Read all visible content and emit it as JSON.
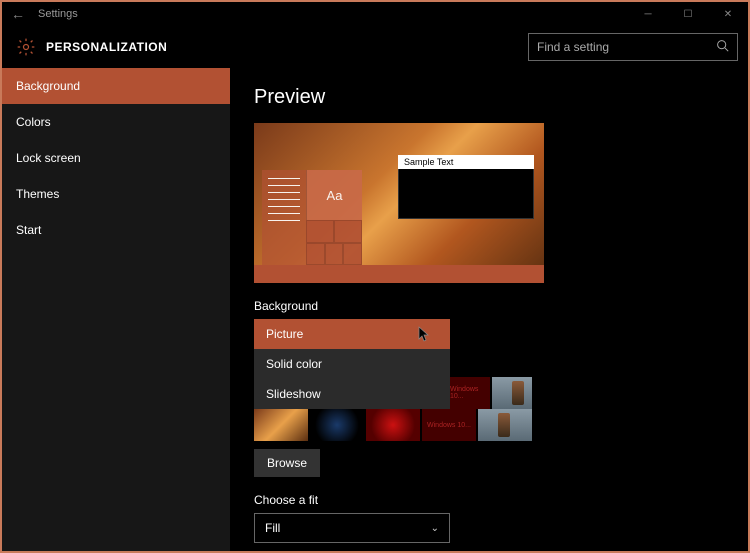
{
  "titlebar": {
    "title": "Settings"
  },
  "header": {
    "title": "PERSONALIZATION"
  },
  "search": {
    "placeholder": "Find a setting"
  },
  "sidebar": {
    "items": [
      {
        "label": "Background",
        "active": true
      },
      {
        "label": "Colors"
      },
      {
        "label": "Lock screen"
      },
      {
        "label": "Themes"
      },
      {
        "label": "Start"
      }
    ]
  },
  "content": {
    "preview_title": "Preview",
    "preview_sample": "Sample Text",
    "preview_tile_text": "Aa",
    "background_label": "Background",
    "dropdown": {
      "options": [
        "Picture",
        "Solid color",
        "Slideshow"
      ],
      "selected": "Picture"
    },
    "thumb4_text": "Windows 10...",
    "browse_label": "Browse",
    "fit_label": "Choose a fit",
    "fit_value": "Fill"
  },
  "colors": {
    "accent": "#b25133"
  }
}
